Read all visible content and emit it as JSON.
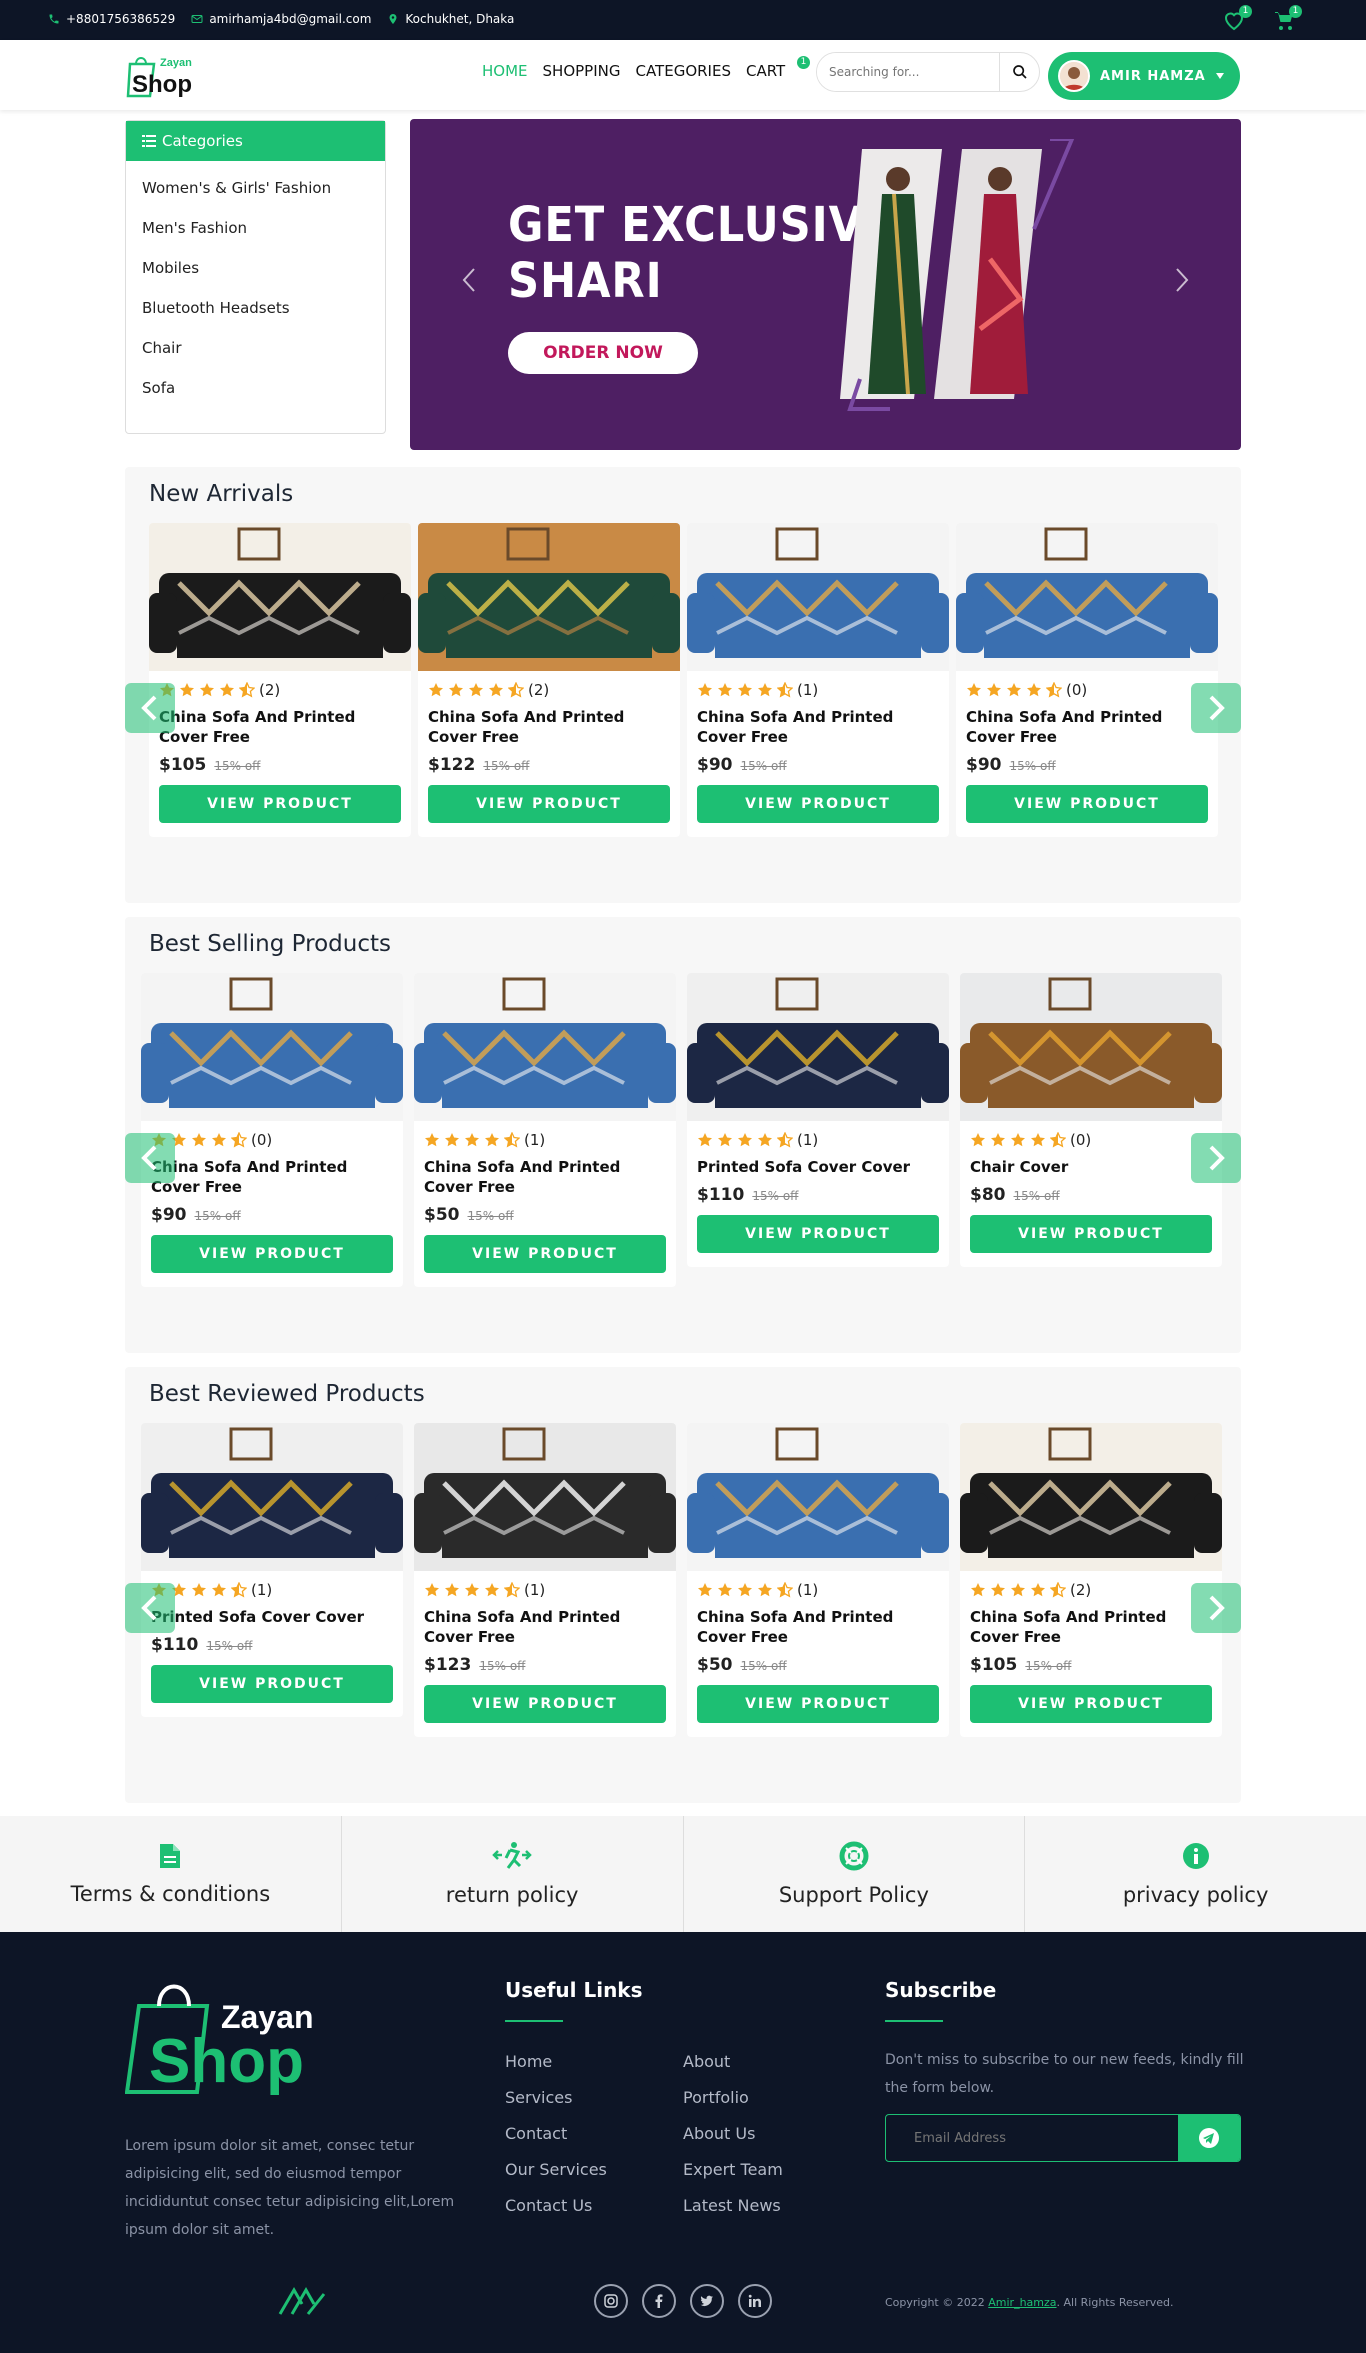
{
  "topbar": {
    "phone": "+8801756386529",
    "email": "amirhamja4bd@gmail.com",
    "location": "Kochukhet, Dhaka",
    "wishlist_count": "1",
    "cart_count": "1"
  },
  "header": {
    "logo_top": "Zayan",
    "logo_bottom": "Shop",
    "nav": [
      {
        "label": "HOME"
      },
      {
        "label": "SHOPPING"
      },
      {
        "label": "CATEGORIES"
      },
      {
        "label": "CART"
      }
    ],
    "cart_badge": "1",
    "search_placeholder": "Searching for...",
    "user_name": "AMIR HAMZA"
  },
  "categories": {
    "title": "Categories",
    "items": [
      {
        "label": "Women's & Girls' Fashion"
      },
      {
        "label": "Men's Fashion"
      },
      {
        "label": "Mobiles"
      },
      {
        "label": "Bluetooth Headsets"
      },
      {
        "label": "Chair"
      },
      {
        "label": "Sofa"
      }
    ]
  },
  "banner": {
    "line1": "GET EXCLUSIVE",
    "line2": "SHARI",
    "cta": "ORDER NOW"
  },
  "colors": {
    "accent": "#1dbf73",
    "dark": "#0d1526",
    "banner": "#4e1f63",
    "star": "#f5a623"
  },
  "sections": [
    {
      "title": "New Arrivals",
      "products": [
        {
          "rating": 4.5,
          "reviews": "(2)",
          "name": "China Sofa And Printed Cover Free",
          "price": "$105",
          "discount": "15% off",
          "button": "VIEW PRODUCT"
        },
        {
          "rating": 4.5,
          "reviews": "(2)",
          "name": "China Sofa And Printed Cover Free",
          "price": "$122",
          "discount": "15% off",
          "button": "VIEW PRODUCT"
        },
        {
          "rating": 4.5,
          "reviews": "(1)",
          "name": "China Sofa And Printed Cover Free",
          "price": "$90",
          "discount": "15% off",
          "button": "VIEW PRODUCT"
        },
        {
          "rating": 4.5,
          "reviews": "(0)",
          "name": "China Sofa And Printed Cover Free",
          "price": "$90",
          "discount": "15% off",
          "button": "VIEW PRODUCT"
        }
      ]
    },
    {
      "title": "Best Selling Products",
      "products": [
        {
          "rating": 4.5,
          "reviews": "(0)",
          "name": "China Sofa And Printed Cover Free",
          "price": "$90",
          "discount": "15% off",
          "button": "VIEW PRODUCT"
        },
        {
          "rating": 4.5,
          "reviews": "(1)",
          "name": "China Sofa And Printed Cover Free",
          "price": "$50",
          "discount": "15% off",
          "button": "VIEW PRODUCT"
        },
        {
          "rating": 4.5,
          "reviews": "(1)",
          "name": "Printed Sofa Cover Cover",
          "price": "$110",
          "discount": "15% off",
          "button": "VIEW PRODUCT"
        },
        {
          "rating": 4.5,
          "reviews": "(0)",
          "name": "Chair Cover",
          "price": "$80",
          "discount": "15% off",
          "button": "VIEW PRODUCT"
        }
      ]
    },
    {
      "title": "Best Reviewed Products",
      "products": [
        {
          "rating": 4.5,
          "reviews": "(1)",
          "name": "Printed Sofa Cover Cover",
          "price": "$110",
          "discount": "15% off",
          "button": "VIEW PRODUCT"
        },
        {
          "rating": 4.5,
          "reviews": "(1)",
          "name": "China Sofa And Printed Cover Free",
          "price": "$123",
          "discount": "15% off",
          "button": "VIEW PRODUCT"
        },
        {
          "rating": 4.5,
          "reviews": "(1)",
          "name": "China Sofa And Printed Cover Free",
          "price": "$50",
          "discount": "15% off",
          "button": "VIEW PRODUCT"
        },
        {
          "rating": 4.5,
          "reviews": "(2)",
          "name": "China Sofa And Printed Cover Free",
          "price": "$105",
          "discount": "15% off",
          "button": "VIEW PRODUCT"
        }
      ]
    }
  ],
  "policies": [
    {
      "label": "Terms & conditions",
      "icon": "document-icon"
    },
    {
      "label": "return policy",
      "icon": "return-icon"
    },
    {
      "label": "Support Policy",
      "icon": "lifebuoy-icon"
    },
    {
      "label": "privacy policy",
      "icon": "info-icon"
    }
  ],
  "footer": {
    "logo_top": "Zayan",
    "logo_bottom": "Shop",
    "about": "Lorem ipsum dolor sit amet, consec tetur adipisicing elit, sed do eiusmod tempor incididuntut consec tetur adipisicing elit,Lorem ipsum dolor sit amet.",
    "useful_links_title": "Useful Links",
    "links_col1": [
      {
        "label": "Home"
      },
      {
        "label": "Services"
      },
      {
        "label": "Contact"
      },
      {
        "label": "Our Services"
      },
      {
        "label": "Contact Us"
      }
    ],
    "links_col2": [
      {
        "label": "About"
      },
      {
        "label": "Portfolio"
      },
      {
        "label": "About Us"
      },
      {
        "label": "Expert Team"
      },
      {
        "label": "Latest News"
      }
    ],
    "subscribe_title": "Subscribe",
    "subscribe_text": "Don't miss to subscribe to our new feeds, kindly fill the form below.",
    "email_placeholder": "Email Address",
    "copyright_prefix": "Copyright © 2022",
    "copyright_link": "Amir_hamza",
    "copyright_suffix": ". All Rights Reserved."
  }
}
